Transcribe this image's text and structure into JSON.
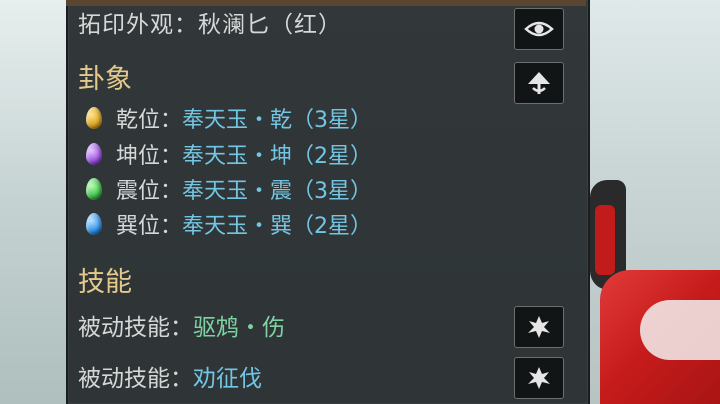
{
  "appearance": {
    "label": "拓印外观：",
    "value": "秋澜匕（红）"
  },
  "trigram": {
    "title": "卦象",
    "items": [
      {
        "label": "乾位：",
        "value": "奉天玉・乾（3星）",
        "color": "#d9a21e"
      },
      {
        "label": "坤位：",
        "value": "奉天玉・坤（2星）",
        "color": "#9b4fe0"
      },
      {
        "label": "震位：",
        "value": "奉天玉・震（3星）",
        "color": "#3fbf4a"
      },
      {
        "label": "巽位：",
        "value": "奉天玉・巽（2星）",
        "color": "#2f8ee6"
      }
    ]
  },
  "skills": {
    "title": "技能",
    "items": [
      {
        "label": "被动技能：",
        "value": "驱鸩・伤"
      },
      {
        "label": "被动技能：",
        "value": "劝征伐"
      }
    ]
  },
  "icons": {
    "eye": "eye-icon",
    "share": "fan-icon",
    "skill": "burst-icon"
  }
}
